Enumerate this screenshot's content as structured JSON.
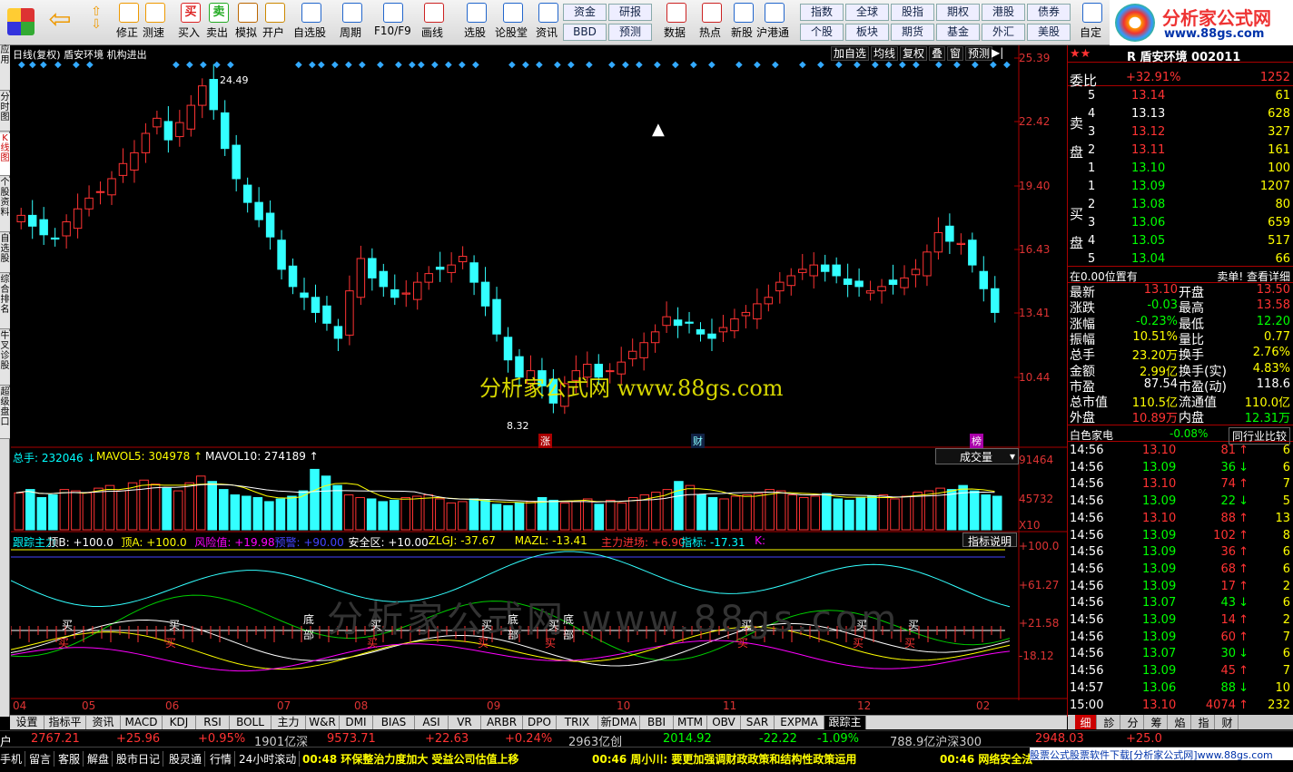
{
  "toolbar": {
    "buttons": [
      {
        "label": "修正",
        "icon": "arrow-up-down-icon"
      },
      {
        "label": "测速",
        "icon": "clock-icon"
      },
      {
        "label": "买入",
        "icon": "buy-icon"
      },
      {
        "label": "卖出",
        "icon": "sell-icon"
      },
      {
        "label": "模拟",
        "icon": "hammer-icon"
      },
      {
        "label": "开户",
        "icon": "lock-icon"
      },
      {
        "label": "自选股",
        "icon": "star-icon"
      },
      {
        "label": "周期",
        "icon": "clock-icon"
      },
      {
        "label": "F10/F9",
        "icon": "document-icon"
      },
      {
        "label": "画线",
        "icon": "pencil-icon"
      },
      {
        "label": "选股",
        "icon": "filter-icon"
      },
      {
        "label": "论股堂",
        "icon": "chat-icon"
      },
      {
        "label": "资讯",
        "icon": "news-icon"
      },
      {
        "label": "数据",
        "icon": "pe-icon"
      },
      {
        "label": "热点",
        "icon": "hot-icon"
      },
      {
        "label": "新股",
        "icon": "new-icon"
      },
      {
        "label": "沪港通",
        "icon": "hk-icon"
      },
      {
        "label": "自定",
        "icon": "custom-icon"
      }
    ],
    "small": [
      "资金",
      "研报",
      "BBD",
      "预测",
      "指数",
      "全球",
      "股指",
      "期权",
      "港股",
      "债券",
      "个股",
      "板块",
      "期货",
      "基金",
      "外汇",
      "美股"
    ],
    "buy_char": "买",
    "sell_char": "卖"
  },
  "logo": {
    "title": "分析家公式网",
    "url": "www.88gs.com"
  },
  "left_tabs": [
    "应用",
    "分时图",
    "K线图",
    "个股资料",
    "自选股",
    "综合排名",
    "牛叉诊股",
    "超级盘口"
  ],
  "chart": {
    "title": "日线(复权)  盾安环境  机构进出",
    "top_buttons": [
      "加自选",
      "均线",
      "复权",
      "叠",
      "窗",
      "预测"
    ],
    "y_ticks": [
      "25.39",
      "22.42",
      "19.40",
      "16.43",
      "13.41",
      "10.44"
    ],
    "high_label": "24.49",
    "low_label": "8.32",
    "markers": [
      "涨",
      "财",
      "榜"
    ],
    "watermark": "分析家公式网  www.88gs.com",
    "chart_data": {
      "type": "candlestick",
      "x_labels": [
        "04",
        "05",
        "06",
        "07",
        "08",
        "09",
        "10",
        "11",
        "12",
        "02"
      ],
      "ylim": [
        8.32,
        25.39
      ],
      "closes": [
        18.1,
        17.6,
        17.2,
        17.0,
        17.8,
        18.4,
        18.9,
        19.2,
        19.8,
        20.5,
        21.0,
        21.9,
        22.6,
        21.6,
        22.4,
        23.2,
        24.1,
        23.0,
        21.2,
        19.8,
        18.7,
        17.9,
        17.1,
        15.6,
        14.8,
        14.3,
        13.6,
        13.1,
        12.4,
        14.6,
        16.1,
        15.2,
        14.8,
        14.3,
        14.5,
        15.0,
        15.4,
        15.6,
        15.8,
        16.2,
        15.0,
        13.9,
        12.6,
        11.4,
        10.6,
        10.9,
        10.2,
        9.4,
        10.3,
        10.9,
        11.2,
        10.6,
        10.9,
        11.3,
        11.8,
        12.2,
        12.7,
        13.4,
        13.0,
        13.1,
        12.6,
        12.4,
        12.9,
        13.3,
        13.6,
        14.0,
        14.3,
        15.0,
        15.3,
        15.6,
        15.8,
        15.5,
        15.3,
        14.9,
        14.8,
        14.6,
        14.8,
        14.9,
        15.2,
        15.6,
        16.4,
        17.3,
        16.9,
        16.8,
        15.8,
        14.7,
        13.6
      ]
    }
  },
  "volume": {
    "legend": [
      {
        "text": "总手: 232046",
        "color": "#0ff"
      },
      {
        "text": "MAVOL5: 304978",
        "color": "#ff0"
      },
      {
        "text": "MAVOL10: 274189",
        "color": "#fff"
      }
    ],
    "select": "成交量",
    "y_ticks": [
      "91464",
      "45732",
      "X10"
    ],
    "chart_data": {
      "type": "bar",
      "values": [
        55,
        60,
        48,
        52,
        60,
        58,
        55,
        62,
        66,
        58,
        70,
        74,
        68,
        62,
        58,
        70,
        80,
        72,
        60,
        52,
        50,
        48,
        42,
        46,
        50,
        58,
        90,
        80,
        66,
        52,
        48,
        46,
        42,
        44,
        48,
        50,
        52,
        46,
        40,
        42,
        46,
        44,
        38,
        36,
        40,
        42,
        48,
        44,
        40,
        42,
        46,
        38,
        44,
        40,
        48,
        52,
        56,
        60,
        72,
        66,
        52,
        48,
        46,
        50,
        52,
        54,
        60,
        58,
        52,
        48,
        50,
        54,
        46,
        44,
        48,
        50,
        52,
        46,
        50,
        56,
        58,
        62,
        60,
        66,
        58,
        52,
        50
      ],
      "ylim": [
        0,
        91464
      ]
    }
  },
  "indicator": {
    "legend": [
      {
        "text": "跟踪主力",
        "color": "#0ff"
      },
      {
        "text": "顶B: +100.0",
        "color": "#fff"
      },
      {
        "text": "顶A: +100.0",
        "color": "#ff0"
      },
      {
        "text": "风险值: +19.98",
        "color": "#f0f"
      },
      {
        "text": "预警: +90.00",
        "color": "#44f"
      },
      {
        "text": "安全区: +10.00",
        "color": "#fff"
      },
      {
        "text": "ZLGJ: -37.67",
        "color": "#ff0"
      },
      {
        "text": "MAZL: -13.41",
        "color": "#ff0"
      },
      {
        "text": "主力进场: +6.90",
        "color": "#f33"
      },
      {
        "text": "指标: -17.31",
        "color": "#0ff"
      },
      {
        "text": "K:",
        "color": "#f0f"
      }
    ],
    "button": "指标说明",
    "y_ticks": [
      "+100.0",
      "+61.27",
      "+21.58",
      "-18.12"
    ],
    "marks": [
      "买",
      "卖",
      "底部"
    ]
  },
  "tabs": [
    "设置",
    "指标平台",
    "资讯",
    "MACD",
    "KDJ",
    "RSI",
    "BOLL",
    "主力",
    "W&R",
    "DMI",
    "BIAS",
    "ASI",
    "VR",
    "ARBR",
    "DPO",
    "TRIX",
    "新DMA",
    "BBI",
    "MTM",
    "OBV",
    "SAR",
    "EXPMA",
    "跟踪主力"
  ],
  "quote": {
    "stars": "★★",
    "name": "R 盾安环境 002011",
    "weibi_label": "委比",
    "weibi": "+32.91%",
    "weicha": "1252",
    "sell_label": "卖盘",
    "buy_label": "买盘",
    "sells": [
      [
        "5",
        "13.14",
        "61"
      ],
      [
        "4",
        "13.13",
        "628"
      ],
      [
        "3",
        "13.12",
        "327"
      ],
      [
        "2",
        "13.11",
        "161"
      ],
      [
        "1",
        "13.10",
        "100"
      ]
    ],
    "buys": [
      [
        "1",
        "13.09",
        "1207"
      ],
      [
        "2",
        "13.08",
        "80"
      ],
      [
        "3",
        "13.06",
        "659"
      ],
      [
        "4",
        "13.05",
        "517"
      ],
      [
        "5",
        "13.04",
        "66"
      ]
    ],
    "pos_text": "在0.00位置有",
    "sell_text": "卖单! 查看详细",
    "stats": [
      [
        "最新",
        "13.10",
        "开盘",
        "13.50"
      ],
      [
        "涨跌",
        "-0.03",
        "最高",
        "13.58"
      ],
      [
        "涨幅",
        "-0.23%",
        "最低",
        "12.20"
      ],
      [
        "振幅",
        "10.51%",
        "量比",
        "0.77"
      ],
      [
        "总手",
        "23.20万",
        "换手",
        "2.76%"
      ],
      [
        "金额",
        "2.99亿",
        "换手(实)",
        "4.83%"
      ],
      [
        "市盈",
        "87.54",
        "市盈(动)",
        "118.6"
      ],
      [
        "总市值",
        "110.5亿",
        "流通值",
        "110.0亿"
      ],
      [
        "外盘",
        "10.89万",
        "内盘",
        "12.31万"
      ]
    ],
    "sector": "白色家电",
    "sector_pct": "-0.08%",
    "compare": "同行业比较",
    "ticks": [
      [
        "14:56",
        "13.10",
        "81",
        "up",
        "6"
      ],
      [
        "14:56",
        "13.09",
        "36",
        "down",
        "6"
      ],
      [
        "14:56",
        "13.10",
        "74",
        "up",
        "7"
      ],
      [
        "14:56",
        "13.09",
        "22",
        "down",
        "5"
      ],
      [
        "14:56",
        "13.10",
        "88",
        "up",
        "13"
      ],
      [
        "14:56",
        "13.09",
        "102",
        "up",
        "8"
      ],
      [
        "14:56",
        "13.09",
        "36",
        "up",
        "6"
      ],
      [
        "14:56",
        "13.09",
        "68",
        "up",
        "6"
      ],
      [
        "14:56",
        "13.09",
        "17",
        "up",
        "2"
      ],
      [
        "14:56",
        "13.07",
        "43",
        "down",
        "6"
      ],
      [
        "14:56",
        "13.09",
        "14",
        "up",
        "2"
      ],
      [
        "14:56",
        "13.09",
        "60",
        "up",
        "7"
      ],
      [
        "14:56",
        "13.07",
        "30",
        "down",
        "6"
      ],
      [
        "14:56",
        "13.09",
        "45",
        "up",
        "7"
      ],
      [
        "14:57",
        "13.06",
        "88",
        "down",
        "10"
      ],
      [
        "15:00",
        "13.10",
        "4074",
        "up",
        "232"
      ]
    ],
    "bottom_tabs": [
      "细",
      "診",
      "分",
      "筹",
      "焰",
      "指",
      "财"
    ]
  },
  "index_bar": [
    "户",
    "2767.21",
    "+25.96",
    "+0.95%",
    "1901亿深",
    "9573.71",
    "+22.63",
    "+0.24%",
    "2963亿创",
    "2014.92",
    "-22.22",
    "-1.09%",
    "788.9亿沪深300",
    "2948.03",
    "+25.0"
  ],
  "news": {
    "tabs": [
      "手机",
      "留言",
      "客服",
      "解盘",
      "股市日记",
      "股灵通",
      "行情",
      "24小时滚动"
    ],
    "items": [
      "00:48 环保整治力度加大 受益公司估值上移",
      "00:46 周小川: 要更加强调财政政策和结构性政策运用",
      "00:46 网络安全法"
    ],
    "ad": "股票公式股票软件下载[分析家公式网]www.88gs.com"
  }
}
